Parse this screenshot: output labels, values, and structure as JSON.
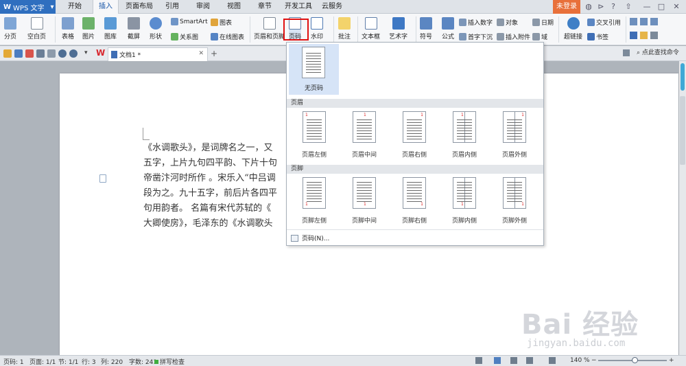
{
  "app": {
    "name": "WPS 文字",
    "logo": "W"
  },
  "menu": {
    "tabs": [
      "开始",
      "插入",
      "页面布局",
      "引用",
      "审阅",
      "视图",
      "章节",
      "开发工具",
      "云服务"
    ],
    "active": "插入",
    "login": "未登录"
  },
  "ribbon": {
    "page_break": "分页",
    "blank_page": "空白页",
    "table": "表格",
    "picture": "图片",
    "gallery": "图库",
    "screenshot": "截屏",
    "shape": "形状",
    "smartart": "SmartArt",
    "chart": "图表",
    "relation": "关系图",
    "online_chart": "在线图表",
    "header_footer": "页眉和页脚",
    "page_number": "页码",
    "watermark": "水印",
    "comment": "批注",
    "textbox": "文本框",
    "wordart": "艺术字",
    "symbol": "符号",
    "formula": "公式",
    "insert_number": "插入数字",
    "object": "对象",
    "date": "日期",
    "drop_cap": "首字下沉",
    "attachment": "插入附件",
    "field": "域",
    "hyperlink": "超链接",
    "cross_ref": "交叉引用",
    "bookmark": "书签"
  },
  "tabs": {
    "doc": "文档1 *",
    "find": "点此查找命令"
  },
  "document": {
    "lines": [
      "《水调歌头》，是词牌名之一，又",
      "五字，上片九句四平韵、下片十句",
      "帝凿汴河时所作 。宋乐入“中吕调",
      "段为之。九十五字，前后片各四平",
      "句用韵者。 名篇有宋代苏轼的《",
      "大卿使房》，毛泽东的《水调歌头"
    ]
  },
  "dropdown": {
    "none": "无页码",
    "header_section": "页眉",
    "footer_section": "页脚",
    "header_items": [
      "页眉左侧",
      "页眉中间",
      "页眉右侧",
      "页眉内侧",
      "页眉外侧"
    ],
    "footer_items": [
      "页脚左侧",
      "页脚中间",
      "页脚右侧",
      "页脚内侧",
      "页脚外侧"
    ],
    "more": "页码(N)...",
    "sample_number": "1"
  },
  "status": {
    "page": "页码: 1",
    "pages": "页面: 1/1",
    "section": "节: 1/1",
    "row": "行: 3",
    "col": "列: 220",
    "words": "字数: 241",
    "spell": "拼写检查",
    "zoom": "140 %"
  },
  "watermark": {
    "main": "Bai 经验",
    "sub": "jingyan.baidu.com"
  },
  "colors": {
    "accent": "#2f6fbf",
    "login": "#e8703a",
    "highlight": "#e01010"
  }
}
